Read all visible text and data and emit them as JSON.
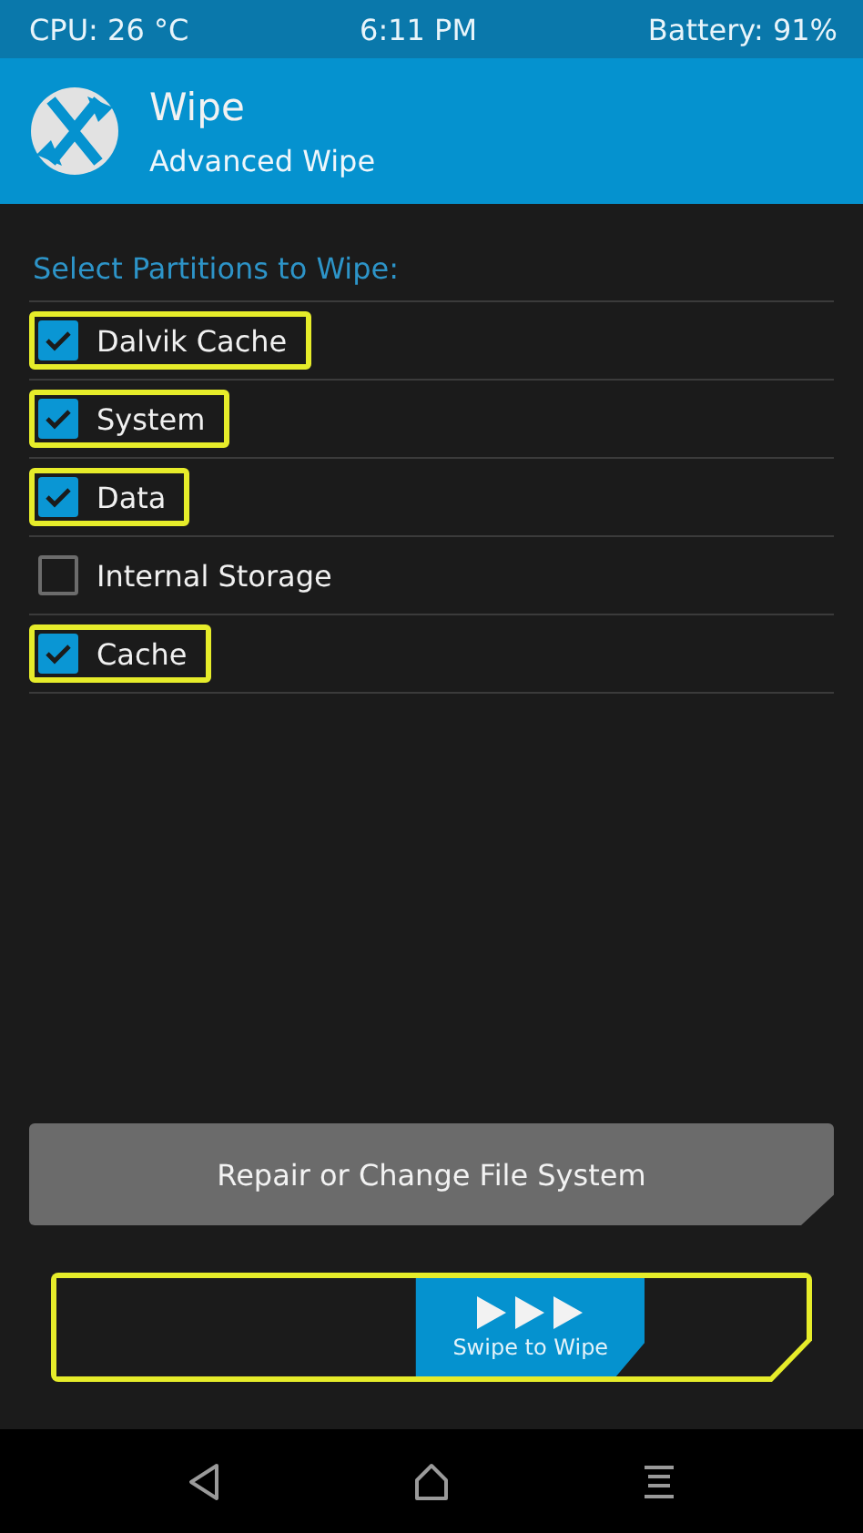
{
  "status_bar": {
    "cpu": "CPU: 26 °C",
    "time": "6:11 PM",
    "battery": "Battery: 91%"
  },
  "header": {
    "title": "Wipe",
    "subtitle": "Advanced Wipe"
  },
  "section_title": "Select Partitions to Wipe:",
  "partitions": [
    {
      "label": "Dalvik Cache",
      "checked": true,
      "highlighted": true
    },
    {
      "label": "System",
      "checked": true,
      "highlighted": true
    },
    {
      "label": "Data",
      "checked": true,
      "highlighted": true
    },
    {
      "label": "Internal Storage",
      "checked": false,
      "highlighted": false
    },
    {
      "label": "Cache",
      "checked": true,
      "highlighted": true
    }
  ],
  "repair_button": "Repair or Change File System",
  "swipe": {
    "label": "Swipe to Wipe",
    "level": 0.7,
    "highlighted": true
  }
}
